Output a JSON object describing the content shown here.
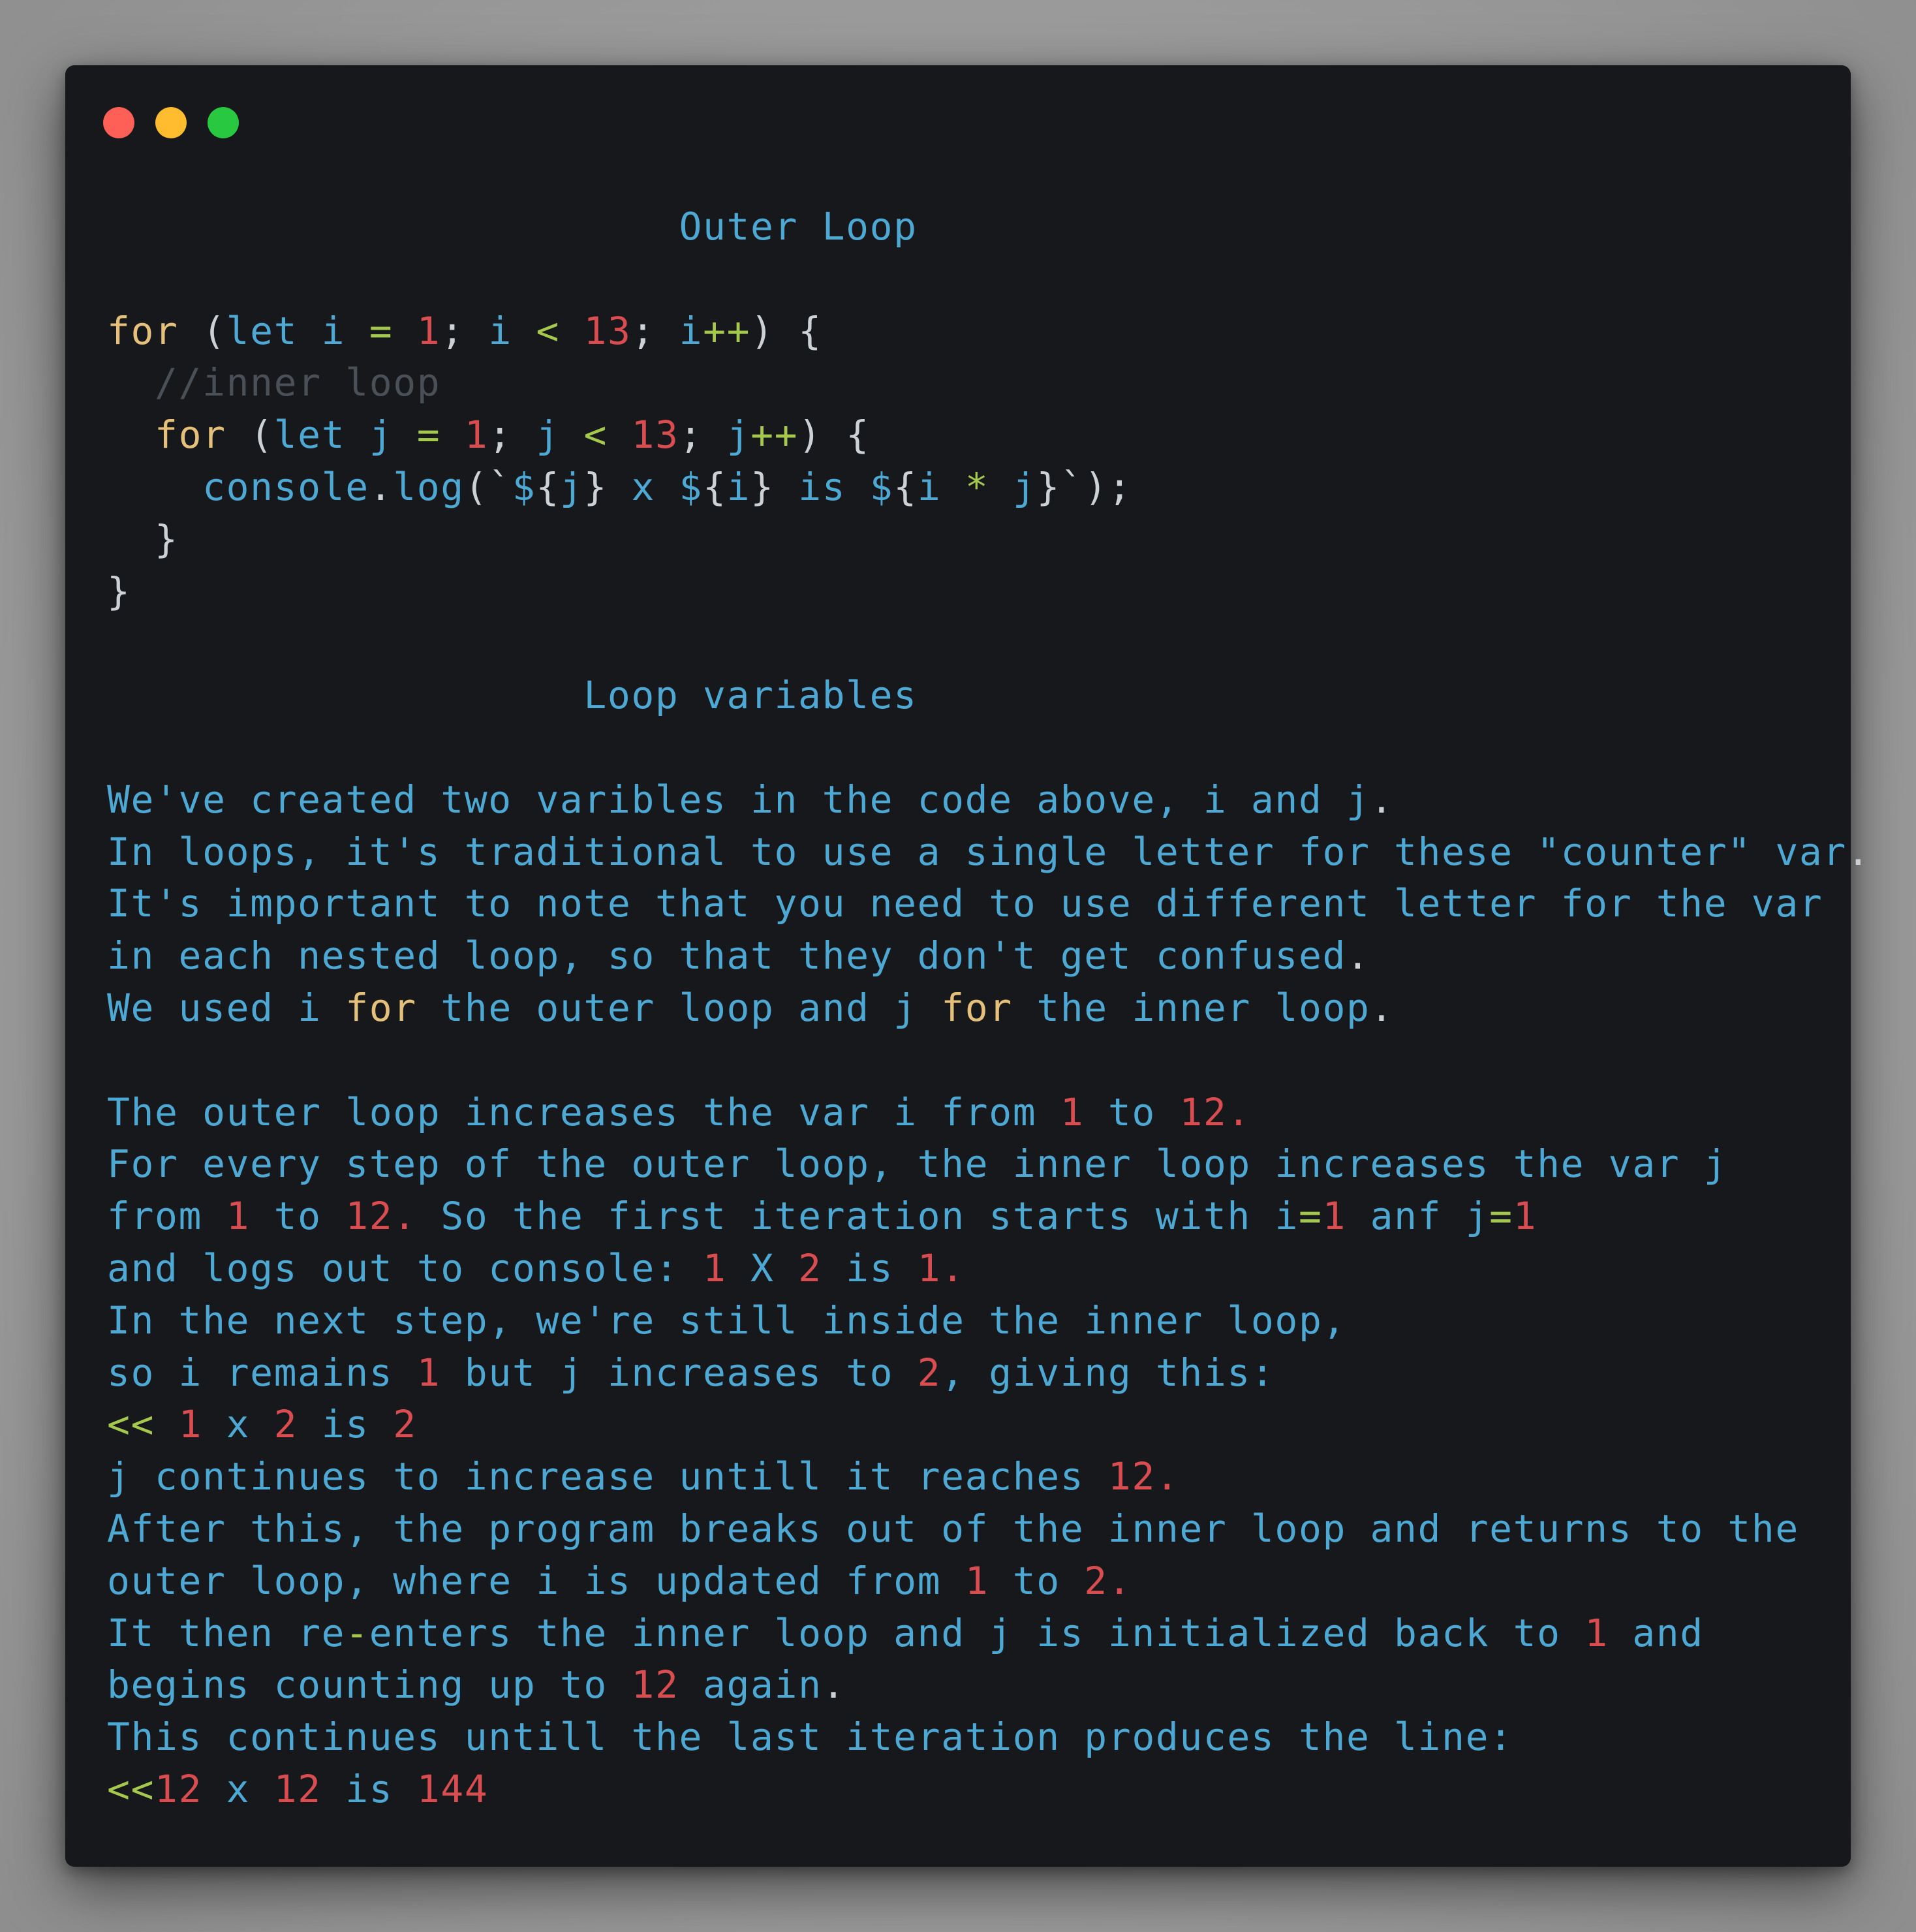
{
  "window": {
    "traffic_lights": [
      {
        "name": "close-dot",
        "color": "#fe5f57"
      },
      {
        "name": "minimize-dot",
        "color": "#febc2e"
      },
      {
        "name": "maximize-dot",
        "color": "#28c840"
      }
    ]
  },
  "colors": {
    "background": "#17181b",
    "keyword": "#e5c07b",
    "number": "#d94d50",
    "operator": "#a5c94d",
    "text": "#4ea8d4",
    "punctuation": "#ccd1d6",
    "comment": "#4a5057"
  },
  "lines": [
    [
      {
        "t": "                        Outer Loop",
        "c": "b"
      }
    ],
    [],
    [
      {
        "t": "for",
        "c": "k"
      },
      {
        "t": " (",
        "c": "w"
      },
      {
        "t": "let i ",
        "c": "b"
      },
      {
        "t": "=",
        "c": "g"
      },
      {
        "t": " ",
        "c": "b"
      },
      {
        "t": "1",
        "c": "r"
      },
      {
        "t": "; ",
        "c": "w"
      },
      {
        "t": "i ",
        "c": "b"
      },
      {
        "t": "<",
        "c": "g"
      },
      {
        "t": " ",
        "c": "b"
      },
      {
        "t": "13",
        "c": "r"
      },
      {
        "t": "; ",
        "c": "w"
      },
      {
        "t": "i",
        "c": "b"
      },
      {
        "t": "++",
        "c": "g"
      },
      {
        "t": ") {",
        "c": "w"
      }
    ],
    [
      {
        "t": "  //inner loop",
        "c": "c"
      }
    ],
    [
      {
        "t": "  ",
        "c": "b"
      },
      {
        "t": "for",
        "c": "k"
      },
      {
        "t": " (",
        "c": "w"
      },
      {
        "t": "let j ",
        "c": "b"
      },
      {
        "t": "=",
        "c": "g"
      },
      {
        "t": " ",
        "c": "b"
      },
      {
        "t": "1",
        "c": "r"
      },
      {
        "t": "; ",
        "c": "w"
      },
      {
        "t": "j ",
        "c": "b"
      },
      {
        "t": "<",
        "c": "g"
      },
      {
        "t": " ",
        "c": "b"
      },
      {
        "t": "13",
        "c": "r"
      },
      {
        "t": "; ",
        "c": "w"
      },
      {
        "t": "j",
        "c": "b"
      },
      {
        "t": "++",
        "c": "g"
      },
      {
        "t": ") {",
        "c": "w"
      }
    ],
    [
      {
        "t": "    console",
        "c": "b"
      },
      {
        "t": ".",
        "c": "w"
      },
      {
        "t": "log",
        "c": "b"
      },
      {
        "t": "(`",
        "c": "w"
      },
      {
        "t": "$",
        "c": "b"
      },
      {
        "t": "{",
        "c": "w"
      },
      {
        "t": "j",
        "c": "b"
      },
      {
        "t": "}",
        "c": "w"
      },
      {
        "t": " x ",
        "c": "b"
      },
      {
        "t": "$",
        "c": "b"
      },
      {
        "t": "{",
        "c": "w"
      },
      {
        "t": "i",
        "c": "b"
      },
      {
        "t": "}",
        "c": "w"
      },
      {
        "t": " is ",
        "c": "b"
      },
      {
        "t": "$",
        "c": "b"
      },
      {
        "t": "{",
        "c": "w"
      },
      {
        "t": "i ",
        "c": "b"
      },
      {
        "t": "*",
        "c": "g"
      },
      {
        "t": " j",
        "c": "b"
      },
      {
        "t": "}`);",
        "c": "w"
      }
    ],
    [
      {
        "t": "  }",
        "c": "w"
      }
    ],
    [
      {
        "t": "}",
        "c": "w"
      }
    ],
    [],
    [
      {
        "t": "                    Loop variables",
        "c": "b"
      }
    ],
    [],
    [
      {
        "t": "We've created two varibles in the code above, i and j",
        "c": "b"
      },
      {
        "t": ".",
        "c": "w"
      }
    ],
    [
      {
        "t": "In loops, it's traditional to use a single letter for these \"counter\" var",
        "c": "b"
      },
      {
        "t": ".",
        "c": "w"
      }
    ],
    [
      {
        "t": "It's important to note that you need to use different letter for the var",
        "c": "b"
      }
    ],
    [
      {
        "t": "in each nested loop, so that they don't get confused",
        "c": "b"
      },
      {
        "t": ".",
        "c": "w"
      }
    ],
    [
      {
        "t": "We used i ",
        "c": "b"
      },
      {
        "t": "for",
        "c": "k"
      },
      {
        "t": " the outer loop and j ",
        "c": "b"
      },
      {
        "t": "for",
        "c": "k"
      },
      {
        "t": " the inner loop",
        "c": "b"
      },
      {
        "t": ".",
        "c": "w"
      }
    ],
    [],
    [
      {
        "t": "The outer loop increases the var i from ",
        "c": "b"
      },
      {
        "t": "1",
        "c": "r"
      },
      {
        "t": " to ",
        "c": "b"
      },
      {
        "t": "12.",
        "c": "r"
      }
    ],
    [
      {
        "t": "For every step of the outer loop, the inner loop increases the var j",
        "c": "b"
      }
    ],
    [
      {
        "t": "from ",
        "c": "b"
      },
      {
        "t": "1",
        "c": "r"
      },
      {
        "t": " to ",
        "c": "b"
      },
      {
        "t": "12.",
        "c": "r"
      },
      {
        "t": " So the first iteration starts with i",
        "c": "b"
      },
      {
        "t": "=",
        "c": "g"
      },
      {
        "t": "1",
        "c": "r"
      },
      {
        "t": " anf j",
        "c": "b"
      },
      {
        "t": "=",
        "c": "g"
      },
      {
        "t": "1",
        "c": "r"
      }
    ],
    [
      {
        "t": "and logs out to console: ",
        "c": "b"
      },
      {
        "t": "1",
        "c": "r"
      },
      {
        "t": " X ",
        "c": "b"
      },
      {
        "t": "2",
        "c": "r"
      },
      {
        "t": " is ",
        "c": "b"
      },
      {
        "t": "1.",
        "c": "r"
      }
    ],
    [
      {
        "t": "In the next step, we're still inside the inner loop,",
        "c": "b"
      }
    ],
    [
      {
        "t": "so i remains ",
        "c": "b"
      },
      {
        "t": "1",
        "c": "r"
      },
      {
        "t": " but j increases to ",
        "c": "b"
      },
      {
        "t": "2",
        "c": "r"
      },
      {
        "t": ", giving this:",
        "c": "b"
      }
    ],
    [
      {
        "t": "<<",
        "c": "g"
      },
      {
        "t": " ",
        "c": "b"
      },
      {
        "t": "1",
        "c": "r"
      },
      {
        "t": " x ",
        "c": "b"
      },
      {
        "t": "2",
        "c": "r"
      },
      {
        "t": " is ",
        "c": "b"
      },
      {
        "t": "2",
        "c": "r"
      }
    ],
    [
      {
        "t": "j continues to increase untill it reaches ",
        "c": "b"
      },
      {
        "t": "12.",
        "c": "r"
      }
    ],
    [
      {
        "t": "After this, the program breaks out of the inner loop and returns to the",
        "c": "b"
      }
    ],
    [
      {
        "t": "outer loop, where i is updated from ",
        "c": "b"
      },
      {
        "t": "1",
        "c": "r"
      },
      {
        "t": " to ",
        "c": "b"
      },
      {
        "t": "2.",
        "c": "r"
      }
    ],
    [
      {
        "t": "It then re",
        "c": "b"
      },
      {
        "t": "-",
        "c": "g"
      },
      {
        "t": "enters the inner loop and j is initialized back to ",
        "c": "b"
      },
      {
        "t": "1",
        "c": "r"
      },
      {
        "t": " and",
        "c": "b"
      }
    ],
    [
      {
        "t": "begins counting up to ",
        "c": "b"
      },
      {
        "t": "12",
        "c": "r"
      },
      {
        "t": " again",
        "c": "b"
      },
      {
        "t": ".",
        "c": "w"
      }
    ],
    [
      {
        "t": "This continues untill the last iteration produces the line:",
        "c": "b"
      }
    ],
    [
      {
        "t": "<<",
        "c": "g"
      },
      {
        "t": "12",
        "c": "r"
      },
      {
        "t": " x ",
        "c": "b"
      },
      {
        "t": "12",
        "c": "r"
      },
      {
        "t": " is ",
        "c": "b"
      },
      {
        "t": "144",
        "c": "r"
      }
    ]
  ]
}
